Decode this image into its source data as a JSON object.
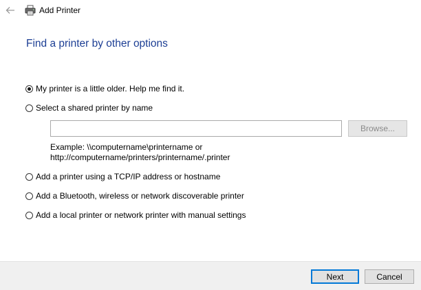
{
  "window": {
    "title": "Add Printer",
    "back_icon": "back-arrow-icon",
    "app_icon": "printer-icon"
  },
  "heading": "Find a printer by other options",
  "options": [
    {
      "label": "My printer is a little older. Help me find it.",
      "checked": true
    },
    {
      "label": "Select a shared printer by name",
      "checked": false
    },
    {
      "label": "Add a printer using a TCP/IP address or hostname",
      "checked": false
    },
    {
      "label": "Add a Bluetooth, wireless or network discoverable printer",
      "checked": false
    },
    {
      "label": "Add a local printer or network printer with manual settings",
      "checked": false
    }
  ],
  "shared_printer": {
    "value": "",
    "placeholder": "",
    "browse_label": "Browse...",
    "browse_enabled": false,
    "example_line1": "Example: \\\\computername\\printername or",
    "example_line2": "http://computername/printers/printername/.printer"
  },
  "footer": {
    "next_label": "Next",
    "cancel_label": "Cancel"
  },
  "colors": {
    "heading": "#1c3e94",
    "default_button_border": "#0078d7",
    "footer_background": "#f0f0f0"
  }
}
